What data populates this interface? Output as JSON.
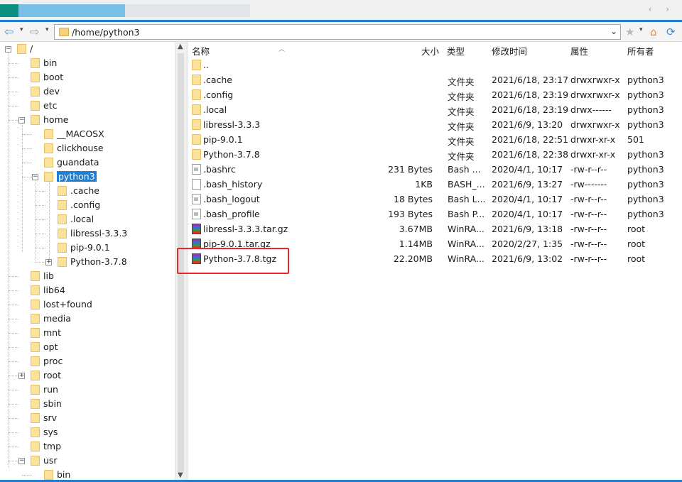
{
  "address": {
    "path": "/home/python3"
  },
  "tree": [
    {
      "label": "/",
      "expander": "-"
    },
    {
      "label": "bin"
    },
    {
      "label": "boot"
    },
    {
      "label": "dev"
    },
    {
      "label": "etc"
    },
    {
      "label": "home",
      "expander": "-"
    },
    {
      "label": "__MACOSX"
    },
    {
      "label": "clickhouse"
    },
    {
      "label": "guandata"
    },
    {
      "label": "python3",
      "expander": "-",
      "selected": true
    },
    {
      "label": ".cache"
    },
    {
      "label": ".config"
    },
    {
      "label": ".local"
    },
    {
      "label": "libressl-3.3.3"
    },
    {
      "label": "pip-9.0.1"
    },
    {
      "label": "Python-3.7.8",
      "expander": "+"
    },
    {
      "label": "lib"
    },
    {
      "label": "lib64"
    },
    {
      "label": "lost+found"
    },
    {
      "label": "media"
    },
    {
      "label": "mnt"
    },
    {
      "label": "opt"
    },
    {
      "label": "proc"
    },
    {
      "label": "root",
      "expander": "+"
    },
    {
      "label": "run"
    },
    {
      "label": "sbin"
    },
    {
      "label": "srv"
    },
    {
      "label": "sys"
    },
    {
      "label": "tmp"
    },
    {
      "label": "usr",
      "expander": "-"
    },
    {
      "label": "bin"
    }
  ],
  "columns": {
    "name": "名称",
    "size": "大小",
    "type": "类型",
    "modified": "修改时间",
    "attrs": "属性",
    "owner": "所有者"
  },
  "files": [
    {
      "name": "..",
      "icon": "folder",
      "size": "",
      "type": "",
      "modified": "",
      "attrs": "",
      "owner": ""
    },
    {
      "name": ".cache",
      "icon": "folder",
      "size": "",
      "type": "文件夹",
      "modified": "2021/6/18, 23:17",
      "attrs": "drwxrwxr-x",
      "owner": "python3"
    },
    {
      "name": ".config",
      "icon": "folder",
      "size": "",
      "type": "文件夹",
      "modified": "2021/6/18, 23:19",
      "attrs": "drwxrwxr-x",
      "owner": "python3"
    },
    {
      "name": ".local",
      "icon": "folder",
      "size": "",
      "type": "文件夹",
      "modified": "2021/6/18, 23:19",
      "attrs": "drwx------",
      "owner": "python3"
    },
    {
      "name": "libressl-3.3.3",
      "icon": "folder",
      "size": "",
      "type": "文件夹",
      "modified": "2021/6/9, 13:20",
      "attrs": "drwxrwxr-x",
      "owner": "python3"
    },
    {
      "name": "pip-9.0.1",
      "icon": "folder",
      "size": "",
      "type": "文件夹",
      "modified": "2021/6/18, 22:51",
      "attrs": "drwxr-xr-x",
      "owner": "501"
    },
    {
      "name": "Python-3.7.8",
      "icon": "folder",
      "size": "",
      "type": "文件夹",
      "modified": "2021/6/18, 22:38",
      "attrs": "drwxr-xr-x",
      "owner": "python3"
    },
    {
      "name": ".bashrc",
      "icon": "doc",
      "size": "231 Bytes",
      "type": "Bash ...",
      "modified": "2020/4/1, 10:17",
      "attrs": "-rw-r--r--",
      "owner": "python3"
    },
    {
      "name": ".bash_history",
      "icon": "plain",
      "size": "1KB",
      "type": "BASH_...",
      "modified": "2021/6/9, 13:27",
      "attrs": "-rw-------",
      "owner": "python3"
    },
    {
      "name": ".bash_logout",
      "icon": "doc",
      "size": "18 Bytes",
      "type": "Bash L...",
      "modified": "2020/4/1, 10:17",
      "attrs": "-rw-r--r--",
      "owner": "python3"
    },
    {
      "name": ".bash_profile",
      "icon": "doc",
      "size": "193 Bytes",
      "type": "Bash P...",
      "modified": "2020/4/1, 10:17",
      "attrs": "-rw-r--r--",
      "owner": "python3"
    },
    {
      "name": "libressl-3.3.3.tar.gz",
      "icon": "rar",
      "size": "3.67MB",
      "type": "WinRA...",
      "modified": "2021/6/9, 13:18",
      "attrs": "-rw-r--r--",
      "owner": "root"
    },
    {
      "name": "pip-9.0.1.tar.gz",
      "icon": "rar",
      "size": "1.14MB",
      "type": "WinRA...",
      "modified": "2020/2/27, 1:35",
      "attrs": "-rw-r--r--",
      "owner": "root"
    },
    {
      "name": "Python-3.7.8.tgz",
      "icon": "rar",
      "size": "22.20MB",
      "type": "WinRA...",
      "modified": "2021/6/9, 13:02",
      "attrs": "-rw-r--r--",
      "owner": "root"
    }
  ],
  "colors": {
    "accent": "#1e7fd4",
    "highlight": "#e8262c",
    "folder": "#fbe29b"
  }
}
